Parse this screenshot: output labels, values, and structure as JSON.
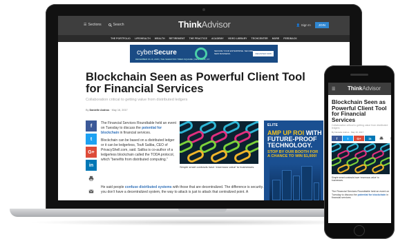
{
  "site": {
    "logo_bold": "Think",
    "logo_light": "Advisor",
    "sections_label": "Sections",
    "search_label": "Search",
    "signin_label": "Sign In",
    "join_label": "JOIN"
  },
  "nav": [
    "THE PORTFOLIO",
    "LIFE/HEALTH",
    "WEALTH",
    "RETIREMENT",
    "THE PRACTICE",
    "ACADEMY",
    "VIDEO LIBRARY",
    "TECHCENTER",
    "MORE",
    "FEEDBACK"
  ],
  "banner_ad": {
    "brand_a": "cyber",
    "brand_b": "Secure",
    "date": "DECEMBER 15-16, 2015 | THE SHERATON TIMES SQUARE | NEW YORK, NY",
    "copy": "SECURE YOUR ENTERPRISE. SECURE NEW BUSINESS.",
    "cta": "REGISTER NOW"
  },
  "article": {
    "title": "Blockchain Seen as Powerful Client Tool for Financial Services",
    "subtitle": "Collaboration critical to getting value from distributed ledgers",
    "byline_prefix": "By",
    "author": "Danielle Andrus",
    "date": "May 16, 2017",
    "p1_pre": "The Financial Services Roundtable held an event on Tuesday to discuss the ",
    "p1_link": "potential for blockchain",
    "p1_post": " in financial services.",
    "p2": "Blockchain can be based on a distributed ledger or it can be ledgerless, Toufi Saliba, CEO of PrivacyShell.com, said. Saliba is co-author of a ledgerless blockchain called the TODA protocol, which “benefits from distributed computing.”",
    "p3_pre": "He said people ",
    "p3_link": "confuse distributed systems",
    "p3_post": " with those that are decentralized. The difference is security. “If you don’t have a decentralized system, the way to attack is just to attack that centralized point. A",
    "caption": "Simple smart contracts have ‘enormous value’ to businesses."
  },
  "social": [
    "f",
    "t",
    "G+",
    "in"
  ],
  "side_ad": {
    "tag": "ELITE",
    "headline_a": "AMP UP ROI",
    "headline_b": " WITH FUTURE-PROOF TECHNOLOGY.",
    "sub": "STOP BY OUR BOOTH FOR A CHANCE TO WIN $1,000!"
  },
  "phone": {
    "title": "Blockchain Seen as Powerful Client Tool for Financial Services",
    "subtitle": "Collaboration critical to getting value from distributed ledgers",
    "byline": "By Danielle Andrus · May 16, 2017",
    "caption": "Simple smart contracts have ‘enormous value’ to businesses.",
    "text_pre": "The Financial Services Roundtable held an event on Tuesday to discuss the ",
    "text_link": "potential for blockchain",
    "text_post": " in financial services."
  },
  "colors": {
    "header": "#3e3e3e",
    "link": "#2f6fb7",
    "facebook": "#3b5998",
    "twitter": "#1da1f2",
    "google": "#dd4b39",
    "linkedin": "#0077b5",
    "ad_blue": "#1a4f91",
    "ad_yellow": "#f3c01c"
  }
}
